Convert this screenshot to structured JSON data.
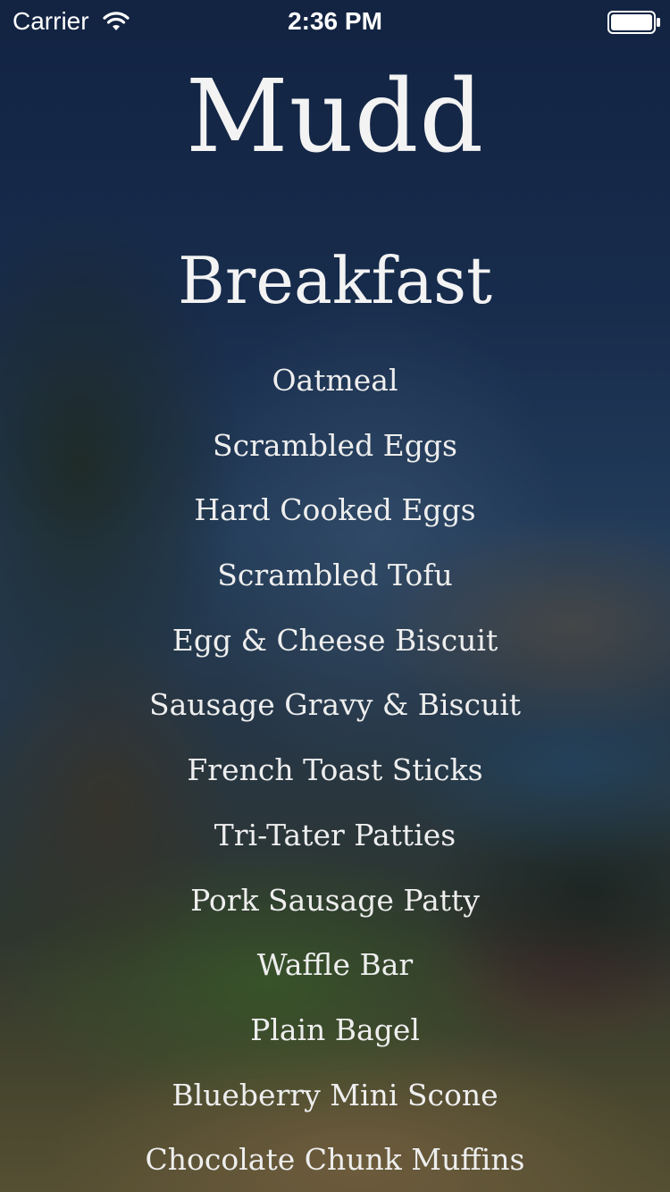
{
  "status_bar": {
    "carrier": "Carrier",
    "time": "2:36 PM",
    "wifi_icon": "wifi-icon",
    "battery_icon": "battery-icon"
  },
  "hall": {
    "title": "Mudd"
  },
  "meal": {
    "title": "Breakfast"
  },
  "menu": {
    "items": [
      {
        "label": "Oatmeal"
      },
      {
        "label": "Scrambled Eggs"
      },
      {
        "label": "Hard Cooked Eggs"
      },
      {
        "label": "Scrambled Tofu"
      },
      {
        "label": "Egg & Cheese Biscuit"
      },
      {
        "label": "Sausage Gravy & Biscuit"
      },
      {
        "label": "French Toast Sticks"
      },
      {
        "label": "Tri-Tater Patties"
      },
      {
        "label": "Pork Sausage Patty"
      },
      {
        "label": "Waffle Bar"
      },
      {
        "label": "Plain Bagel"
      },
      {
        "label": "Blueberry Mini Scone"
      },
      {
        "label": "Chocolate Chunk Muffins"
      }
    ]
  },
  "colors": {
    "text": "#f2f2f2",
    "background_top": "#16294a",
    "background_bottom": "#6b6036"
  }
}
